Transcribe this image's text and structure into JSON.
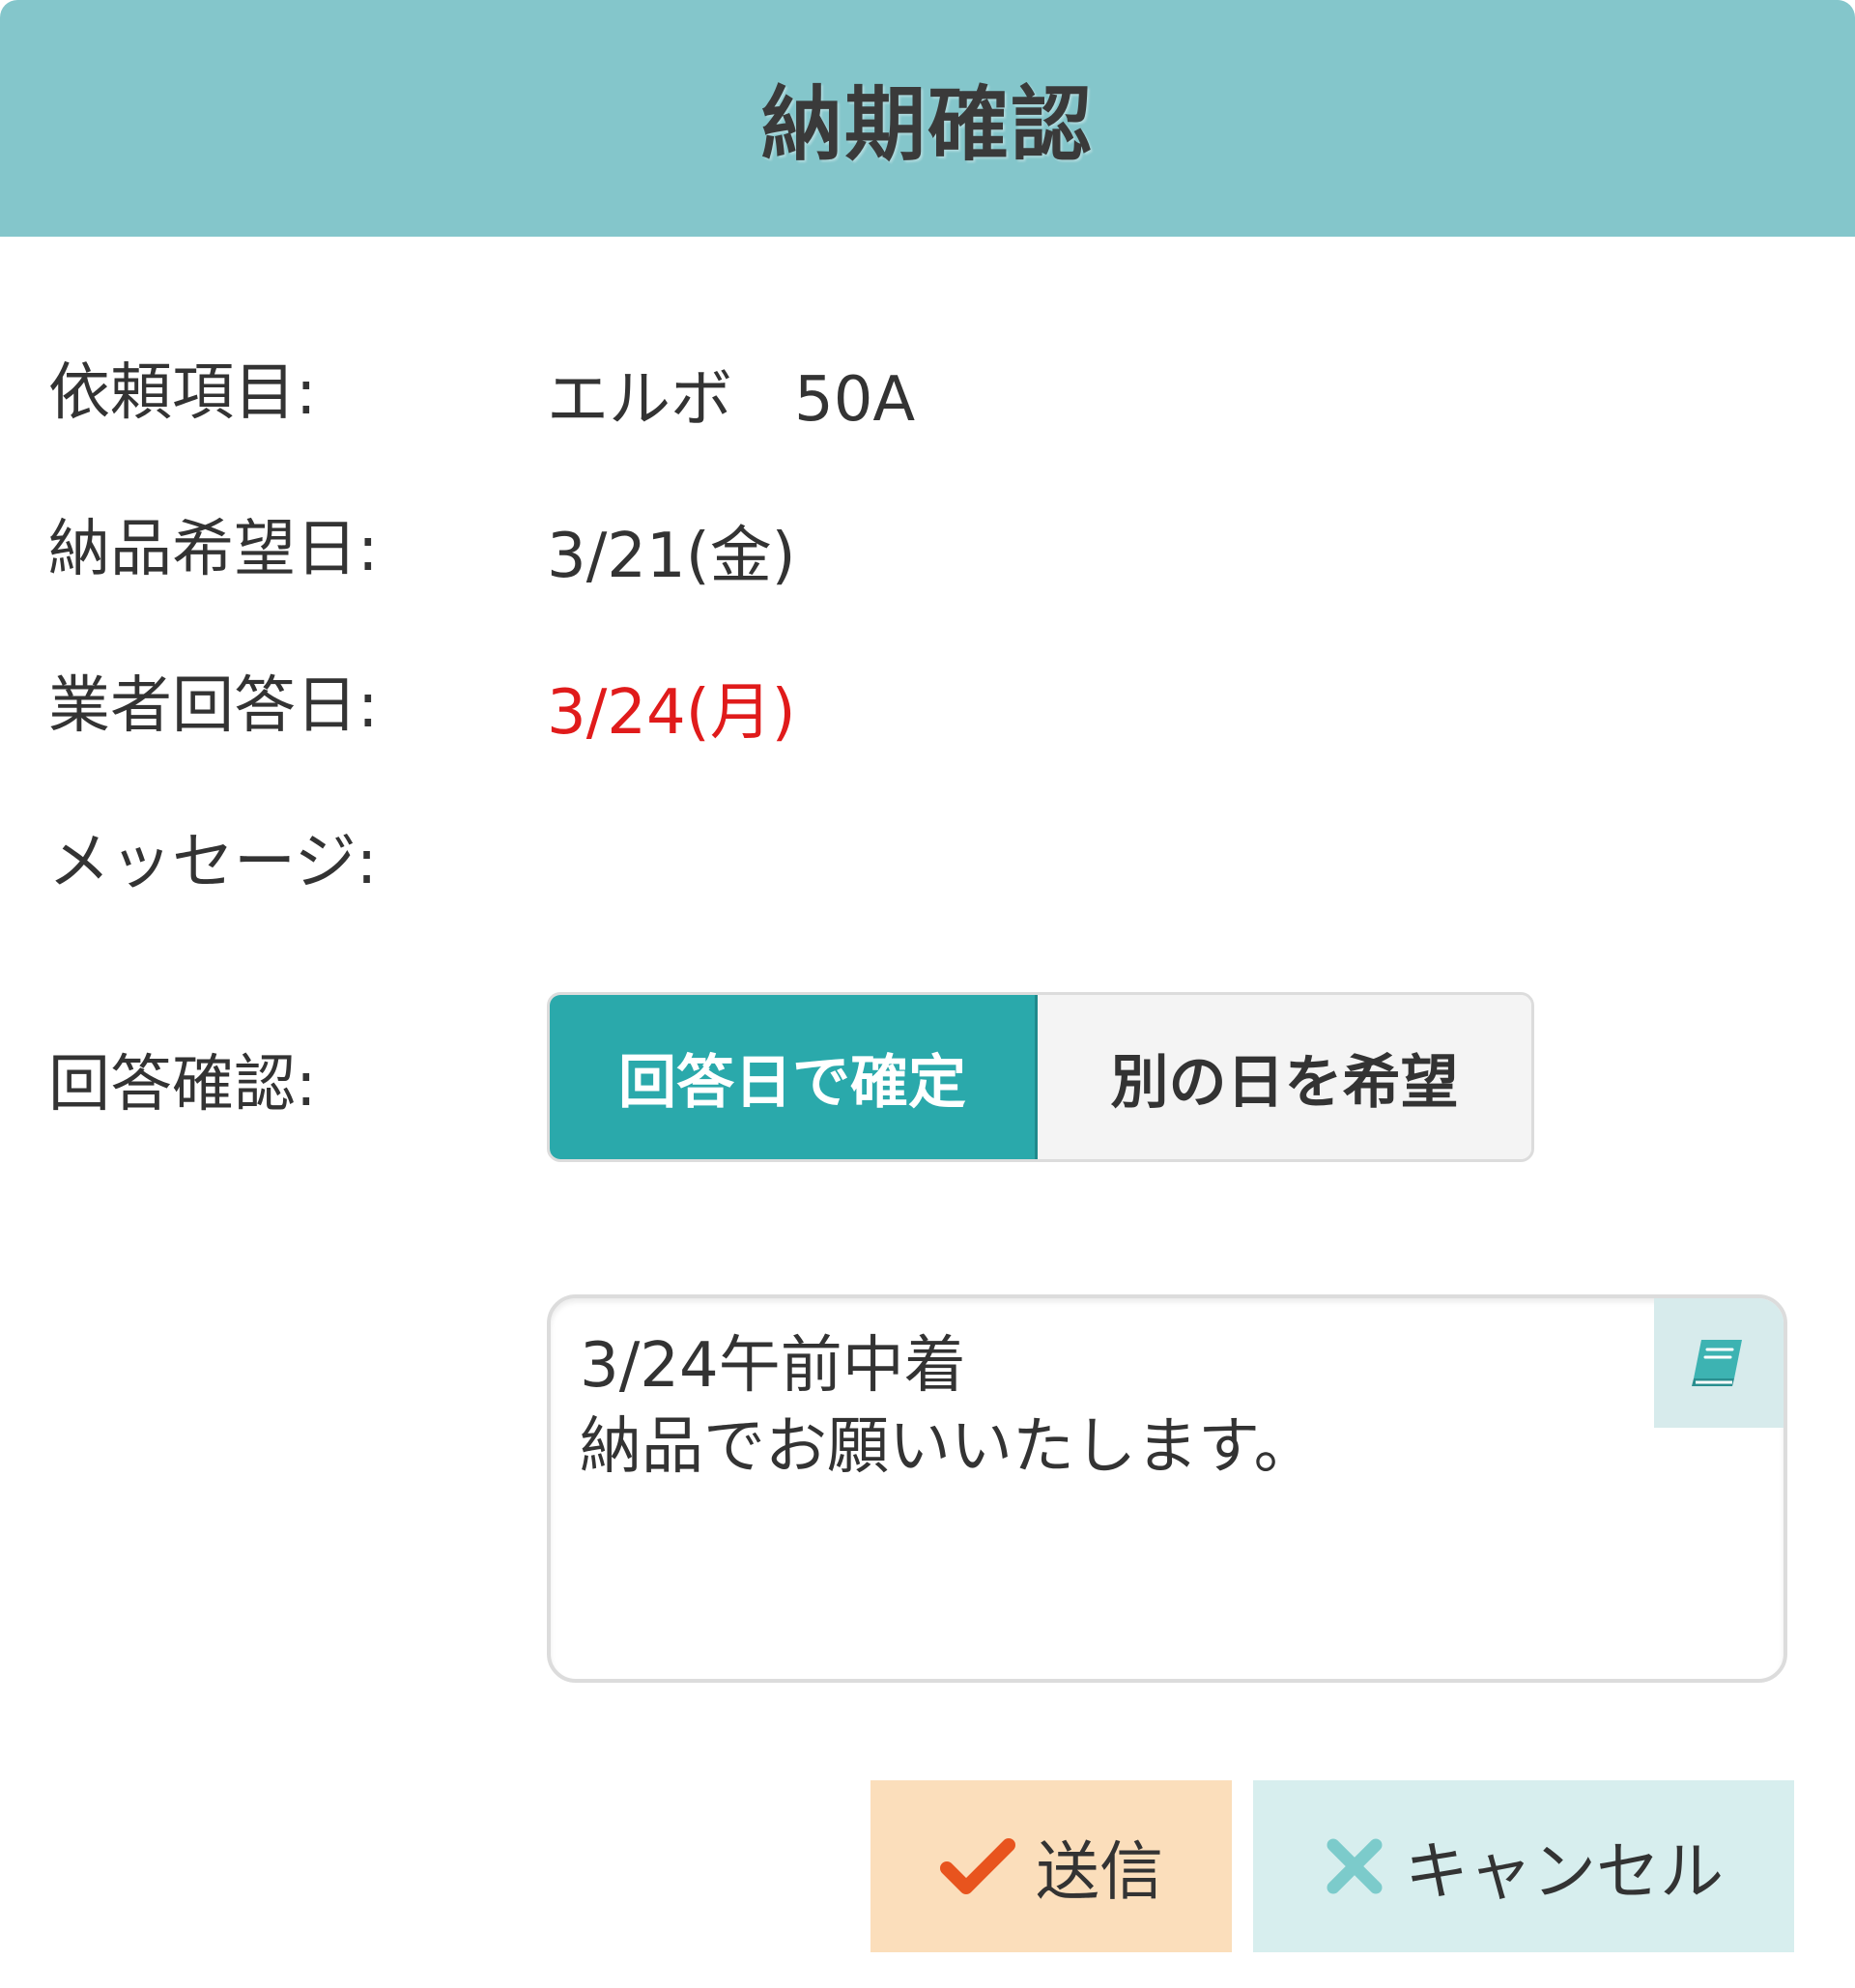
{
  "dialog": {
    "title": "納期確認"
  },
  "fields": [
    {
      "label": "依頼項目:",
      "value": "エルボ　50A"
    },
    {
      "label": "納品希望日:",
      "value": "3/21(金)"
    },
    {
      "label": "業者回答日:",
      "value": "3/24(月)",
      "color": "#e01b1b"
    },
    {
      "label": "メッセージ:",
      "value": ""
    }
  ],
  "confirm": {
    "label": "回答確認:",
    "options": [
      "回答日で確定",
      "別の日を希望"
    ],
    "selected": "回答日で確定"
  },
  "message_box": {
    "value": "3/24午前中着\n納品でお願いいたします。",
    "icon": "book-icon"
  },
  "actions": {
    "send_label": "送信",
    "send_icon": "check-icon",
    "cancel_label": "キャンセル",
    "cancel_icon": "close-icon"
  },
  "colors": {
    "header_bg": "#84c6cb",
    "accent": "#2aa9ab",
    "send_bg": "#fbdebb",
    "cancel_bg": "#d7eeee",
    "alert_red": "#e01b1b",
    "check_orange": "#e8541e"
  }
}
